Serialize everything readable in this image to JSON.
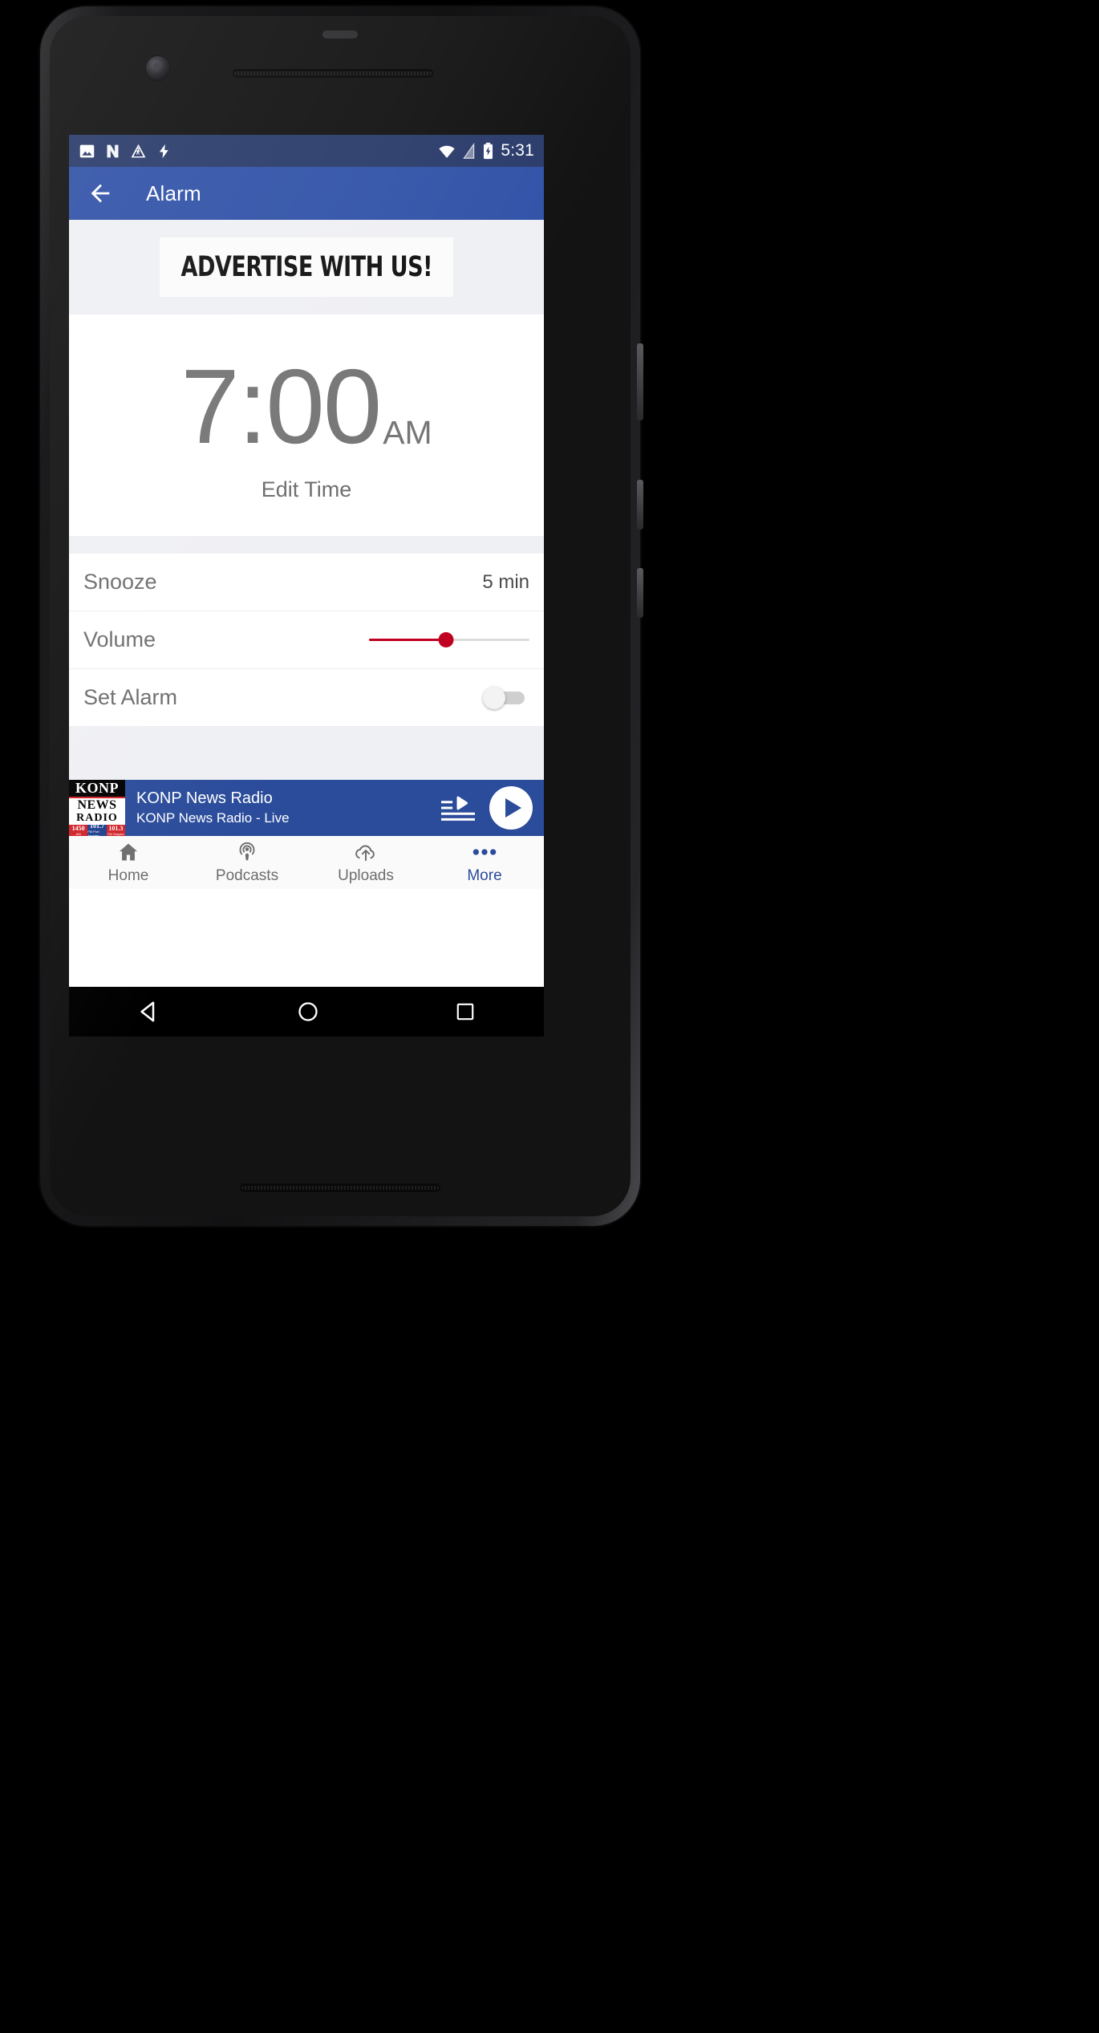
{
  "statusbar": {
    "time": "5:31",
    "left_icons": [
      "image-icon",
      "nova-launcher-icon",
      "pedestrian-warning-icon",
      "charging-bolt-icon"
    ],
    "right_icons": [
      "wifi-icon",
      "mobile-signal-icon",
      "battery-charging-icon"
    ]
  },
  "appbar": {
    "back_icon": "back-arrow-icon",
    "title": "Alarm",
    "bg_color": "#3253a8"
  },
  "ad": {
    "text": "ADVERTISE WITH US!"
  },
  "clock": {
    "time": "7:00",
    "meridiem": "AM",
    "edit_label": "Edit Time"
  },
  "settings": {
    "rows": [
      {
        "label": "Snooze",
        "value": "5 min",
        "control": "value"
      },
      {
        "label": "Volume",
        "value": "",
        "control": "slider"
      },
      {
        "label": "Set Alarm",
        "value": "",
        "control": "toggle"
      }
    ],
    "volume_percent": 48,
    "set_alarm_on": false,
    "slider_color": "#c00020"
  },
  "player": {
    "title": "KONP News Radio",
    "subtitle": "KONP News Radio - Live",
    "bg_color": "#2b4c9b",
    "queue_icon": "playlist-queue-icon",
    "play_icon": "play-icon",
    "logo": {
      "call_sign": "KONP",
      "line2": "NEWS",
      "line3": "RADIO",
      "freqs": [
        {
          "num": "1450",
          "band": "AM"
        },
        {
          "num": "101.7",
          "band": "FM Port Angeles"
        },
        {
          "num": "101.3",
          "band": "FM   Sequim"
        }
      ]
    }
  },
  "bottomnav": {
    "items": [
      {
        "label": "Home",
        "icon": "home-icon",
        "active": false
      },
      {
        "label": "Podcasts",
        "icon": "podcast-icon",
        "active": false
      },
      {
        "label": "Uploads",
        "icon": "cloud-upload-icon",
        "active": false
      },
      {
        "label": "More",
        "icon": "more-dots-icon",
        "active": true
      }
    ],
    "active_color": "#2b4c9b"
  },
  "sysnav": {
    "buttons": [
      "back-triangle-icon",
      "home-circle-icon",
      "recents-square-icon"
    ]
  }
}
